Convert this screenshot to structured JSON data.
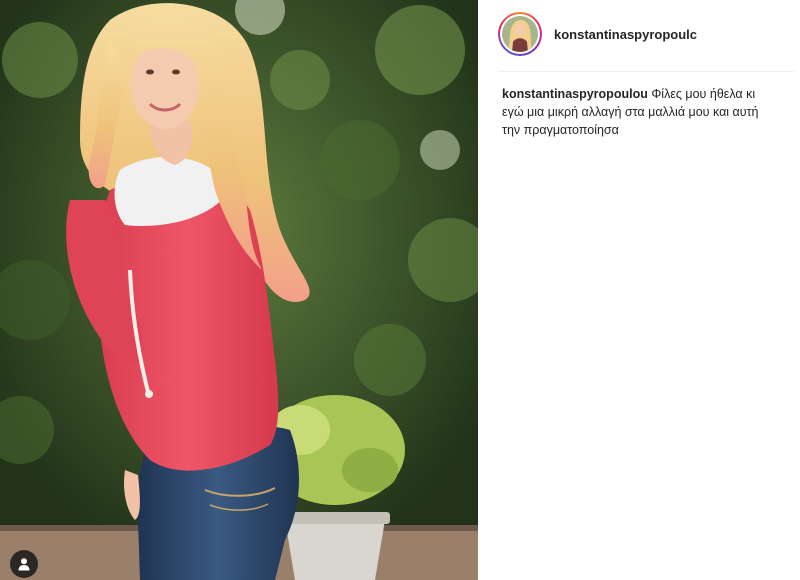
{
  "post": {
    "username": "konstantinaspyropoulou",
    "header_username_display": "konstantinaspyropoulc",
    "caption_text": "Φίλες μου ήθελα κι εγώ μια μικρή αλλαγή στα μαλλιά μου και αυτή την πραγματοποίησα"
  },
  "icons": {
    "user_tag": "person-icon"
  },
  "colors": {
    "username_text": "#262626",
    "divider": "#efefef",
    "hoodie": "#e64a5c",
    "jeans": "#2c4566",
    "hair": "#f2c987"
  }
}
